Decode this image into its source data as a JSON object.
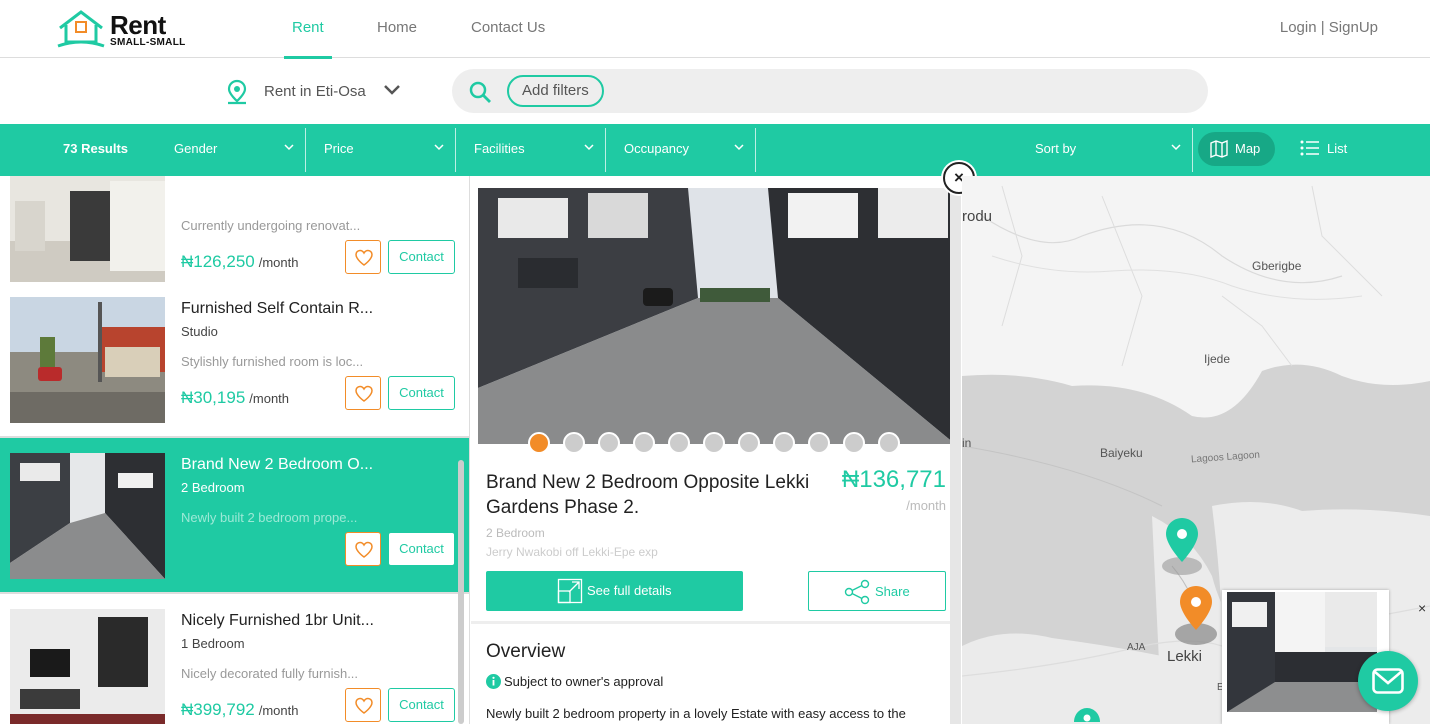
{
  "brand": {
    "name_line1": "Rent",
    "name_line2": "SMALL-SMALL",
    "accent": "#1fcaa3",
    "orange": "#f28c28"
  },
  "nav": {
    "items": [
      "Rent",
      "Home",
      "Contact Us"
    ],
    "active": "Rent",
    "login": "Login | SignUp"
  },
  "search": {
    "location": "Rent in Eti-Osa",
    "filters_label": "Add filters"
  },
  "filterbar": {
    "results": "73 Results",
    "dropdowns": [
      "Gender",
      "Price",
      "Facilities",
      "Occupancy"
    ],
    "sort_label": "Sort by",
    "map_label": "Map",
    "list_label": "List"
  },
  "listings": [
    {
      "title": "",
      "subtitle": "",
      "desc": "Currently undergoing renovat...",
      "price": "₦126,250",
      "per": "/month",
      "contact": "Contact",
      "selected": false
    },
    {
      "title": "Furnished Self Contain R...",
      "subtitle": "Studio",
      "desc": "Stylishly furnished room is loc...",
      "price": "₦30,195",
      "per": "/month",
      "contact": "Contact",
      "selected": false
    },
    {
      "title": "Brand New 2 Bedroom O...",
      "subtitle": "2 Bedroom",
      "desc": "Newly built 2 bedroom prope...",
      "price": "",
      "per": "",
      "contact": "Contact",
      "selected": true
    },
    {
      "title": "Nicely Furnished 1br Unit...",
      "subtitle": "1 Bedroom",
      "desc": "Nicely decorated fully furnish...",
      "price": "₦399,792",
      "per": "/month",
      "contact": "Contact",
      "selected": false
    }
  ],
  "detail": {
    "title": "Brand New 2 Bedroom Opposite Lekki Gardens Phase 2.",
    "price": "₦136,771",
    "per": "/month",
    "type": "2 Bedroom",
    "address": "Jerry Nwakobi off Lekki-Epe exp",
    "full_details": "See full details",
    "share": "Share",
    "overview_heading": "Overview",
    "approval": "Subject to owner's approval",
    "body": "Newly built 2 bedroom property in a lovely Estate with easy access to the",
    "close": "×",
    "photo_count": 11,
    "active_photo": 0
  },
  "map": {
    "labels": {
      "rodu": "rodu",
      "gberigbe": "Gberigbe",
      "ijede": "Ijede",
      "baiyeku": "Baiyeku",
      "lagoon": "Lagoos Lagoon",
      "in": "in",
      "aja": "AJA",
      "lekki": "Lekki",
      "e": "E"
    },
    "card_close": "×"
  }
}
